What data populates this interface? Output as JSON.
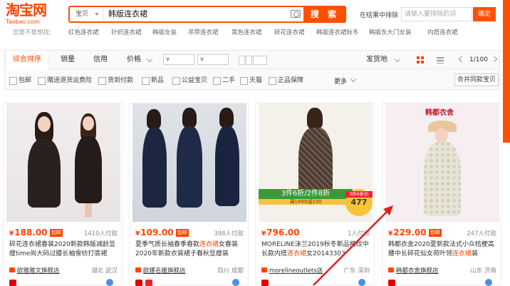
{
  "logo": {
    "cn": "淘宝网",
    "en": "Taobao.com"
  },
  "search": {
    "category": "宝贝",
    "query": "韩版连衣裙",
    "button": "搜 索"
  },
  "exclude": {
    "label": "在结果中排除",
    "placeholder": "请输入要排除的词",
    "button": "确定"
  },
  "suggestions": {
    "lead": "您是不是想找:",
    "items": [
      "红色连衣裙",
      "针织连衣裙",
      "韩版女装",
      "吊带连衣裙",
      "黑色连衣裙",
      "碎花连衣裙",
      "韩版连衣裙秋冬",
      "韩版东大门女装",
      "内搭连衣裙"
    ]
  },
  "sort": {
    "tabs": [
      "综合排序",
      "销量",
      "信用",
      "价格"
    ],
    "price_from": "¥",
    "price_to": "¥",
    "ship_from": "发货地",
    "pager": "1/100"
  },
  "filters": {
    "items": [
      "包邮",
      "赠送退货运费险",
      "货到付款",
      "新品",
      "公益宝贝",
      "二手",
      "天猫",
      "正品保障"
    ],
    "more": "更多",
    "merge": "合并同款宝贝"
  },
  "products": [
    {
      "price": "188.00",
      "tag": "包邮",
      "sales": "1410人付款",
      "title_pre": "碎花连衣裙春装2020新款韩版减龄显瘦time尚大码过膝长袖雪纺打底裙",
      "title_hl": "",
      "title_post": "",
      "shop": "欧雅雅文旗舰店",
      "loc": "湖北 武汉"
    },
    {
      "price": "109.00",
      "tag": "包邮",
      "sales": "398人付款",
      "title_pre": "夏季气质长袖春季春款",
      "title_hl": "连衣裙",
      "title_post": "女春装2020年新款衣装裙子春秋显瘦装",
      "shop": "欧娜名媛旗舰店",
      "loc": "四川 成都"
    },
    {
      "price": "796.00",
      "tag": "",
      "sales": "1人付款",
      "title_pre": "MORELINE沫兰2019秋冬新品格纹中长款内搭",
      "title_hl": "连衣裙",
      "title_post": "女20143303",
      "shop": "morelineoutlets店",
      "loc": "广东 深圳"
    },
    {
      "price": "229.00",
      "tag": "包邮",
      "sales": "247人付款",
      "title_pre": "韩都衣舍2020夏新款法式小众桔梗高腰中长碎花仙女荷叶领",
      "title_hl": "连衣裙",
      "title_post": "装",
      "shop": "韩都衣舍旗舰店",
      "loc": "山东 济南"
    }
  ],
  "promo": {
    "banner": "3件6折/2件8折",
    "sub": "满1899减100",
    "badge_top": "3件6折价",
    "badge_price": "477"
  },
  "brand": {
    "name": "韩都衣舍"
  },
  "colors": {
    "accent": "#ff5000",
    "price": "#ff4400"
  }
}
